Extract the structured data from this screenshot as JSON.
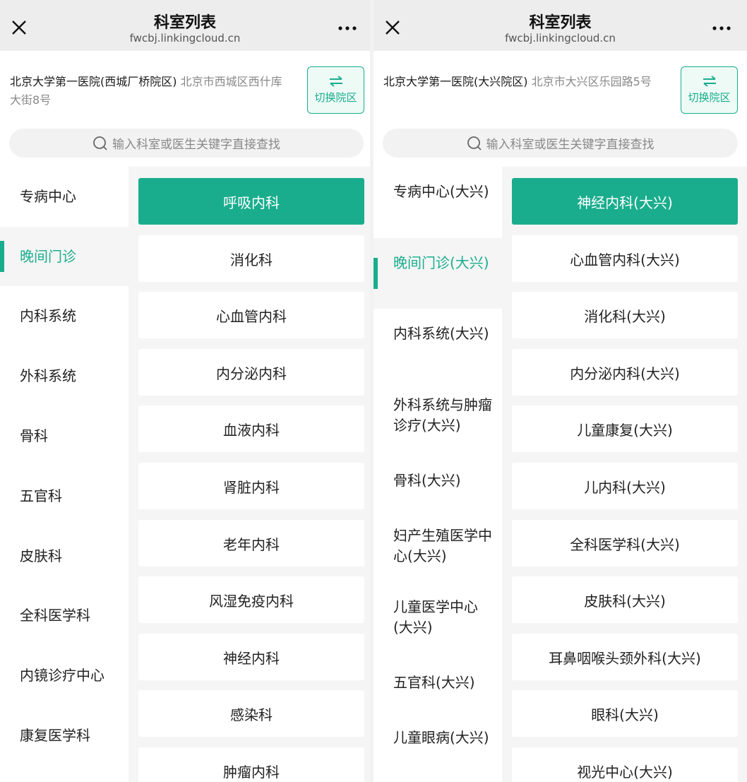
{
  "panels": [
    {
      "title": "科室列表",
      "url": "fwcbj.linkingcloud.cn",
      "hospital_name": "北京大学第一医院(西城厂桥院区)",
      "hospital_address": "北京市西城区西什库大街8号",
      "switch_label": "切换院区",
      "search_placeholder": "输入科室或医生关键字直接查找",
      "categories": [
        "专病中心",
        "晚间门诊",
        "内科系统",
        "外科系统",
        "骨科",
        "五官科",
        "皮肤科",
        "全科医学科",
        "内镜诊疗中心",
        "康复医学科"
      ],
      "active_category_index": 1,
      "departments": [
        "呼吸内科",
        "消化科",
        "心血管内科",
        "内分泌内科",
        "血液内科",
        "肾脏内科",
        "老年内科",
        "风湿免疫内科",
        "神经内科",
        "感染科",
        "肿瘤内科"
      ]
    },
    {
      "title": "科室列表",
      "url": "fwcbj.linkingcloud.cn",
      "hospital_name": "北京大学第一医院(大兴院区)",
      "hospital_address": "北京市大兴区乐园路5号",
      "switch_label": "切换院区",
      "search_placeholder": "输入科室或医生关键字直接查找",
      "categories": [
        "专病中心(大兴)",
        "晚间门诊(大兴)",
        "内科系统(大兴)",
        "外科系统与肿瘤诊疗(大兴)",
        "骨科(大兴)",
        "妇产生殖医学中心(大兴)",
        "儿童医学中心(大兴)",
        "五官科(大兴)",
        "儿童眼病(大兴)"
      ],
      "active_category_index": 1,
      "departments": [
        "神经内科(大兴)",
        "心血管内科(大兴)",
        "消化科(大兴)",
        "内分泌内科(大兴)",
        "儿童康复(大兴)",
        "儿内科(大兴)",
        "全科医学科(大兴)",
        "皮肤科(大兴)",
        "耳鼻咽喉头颈外科(大兴)",
        "眼科(大兴)",
        "视光中心(大兴)"
      ]
    }
  ],
  "icons": {
    "close": "close-icon",
    "more": "more-icon",
    "switch": "swap-icon",
    "search": "search-icon"
  },
  "colors": {
    "accent": "#1aad8d",
    "topbar_bg": "#ededed",
    "list_bg": "#f5f5f5"
  }
}
